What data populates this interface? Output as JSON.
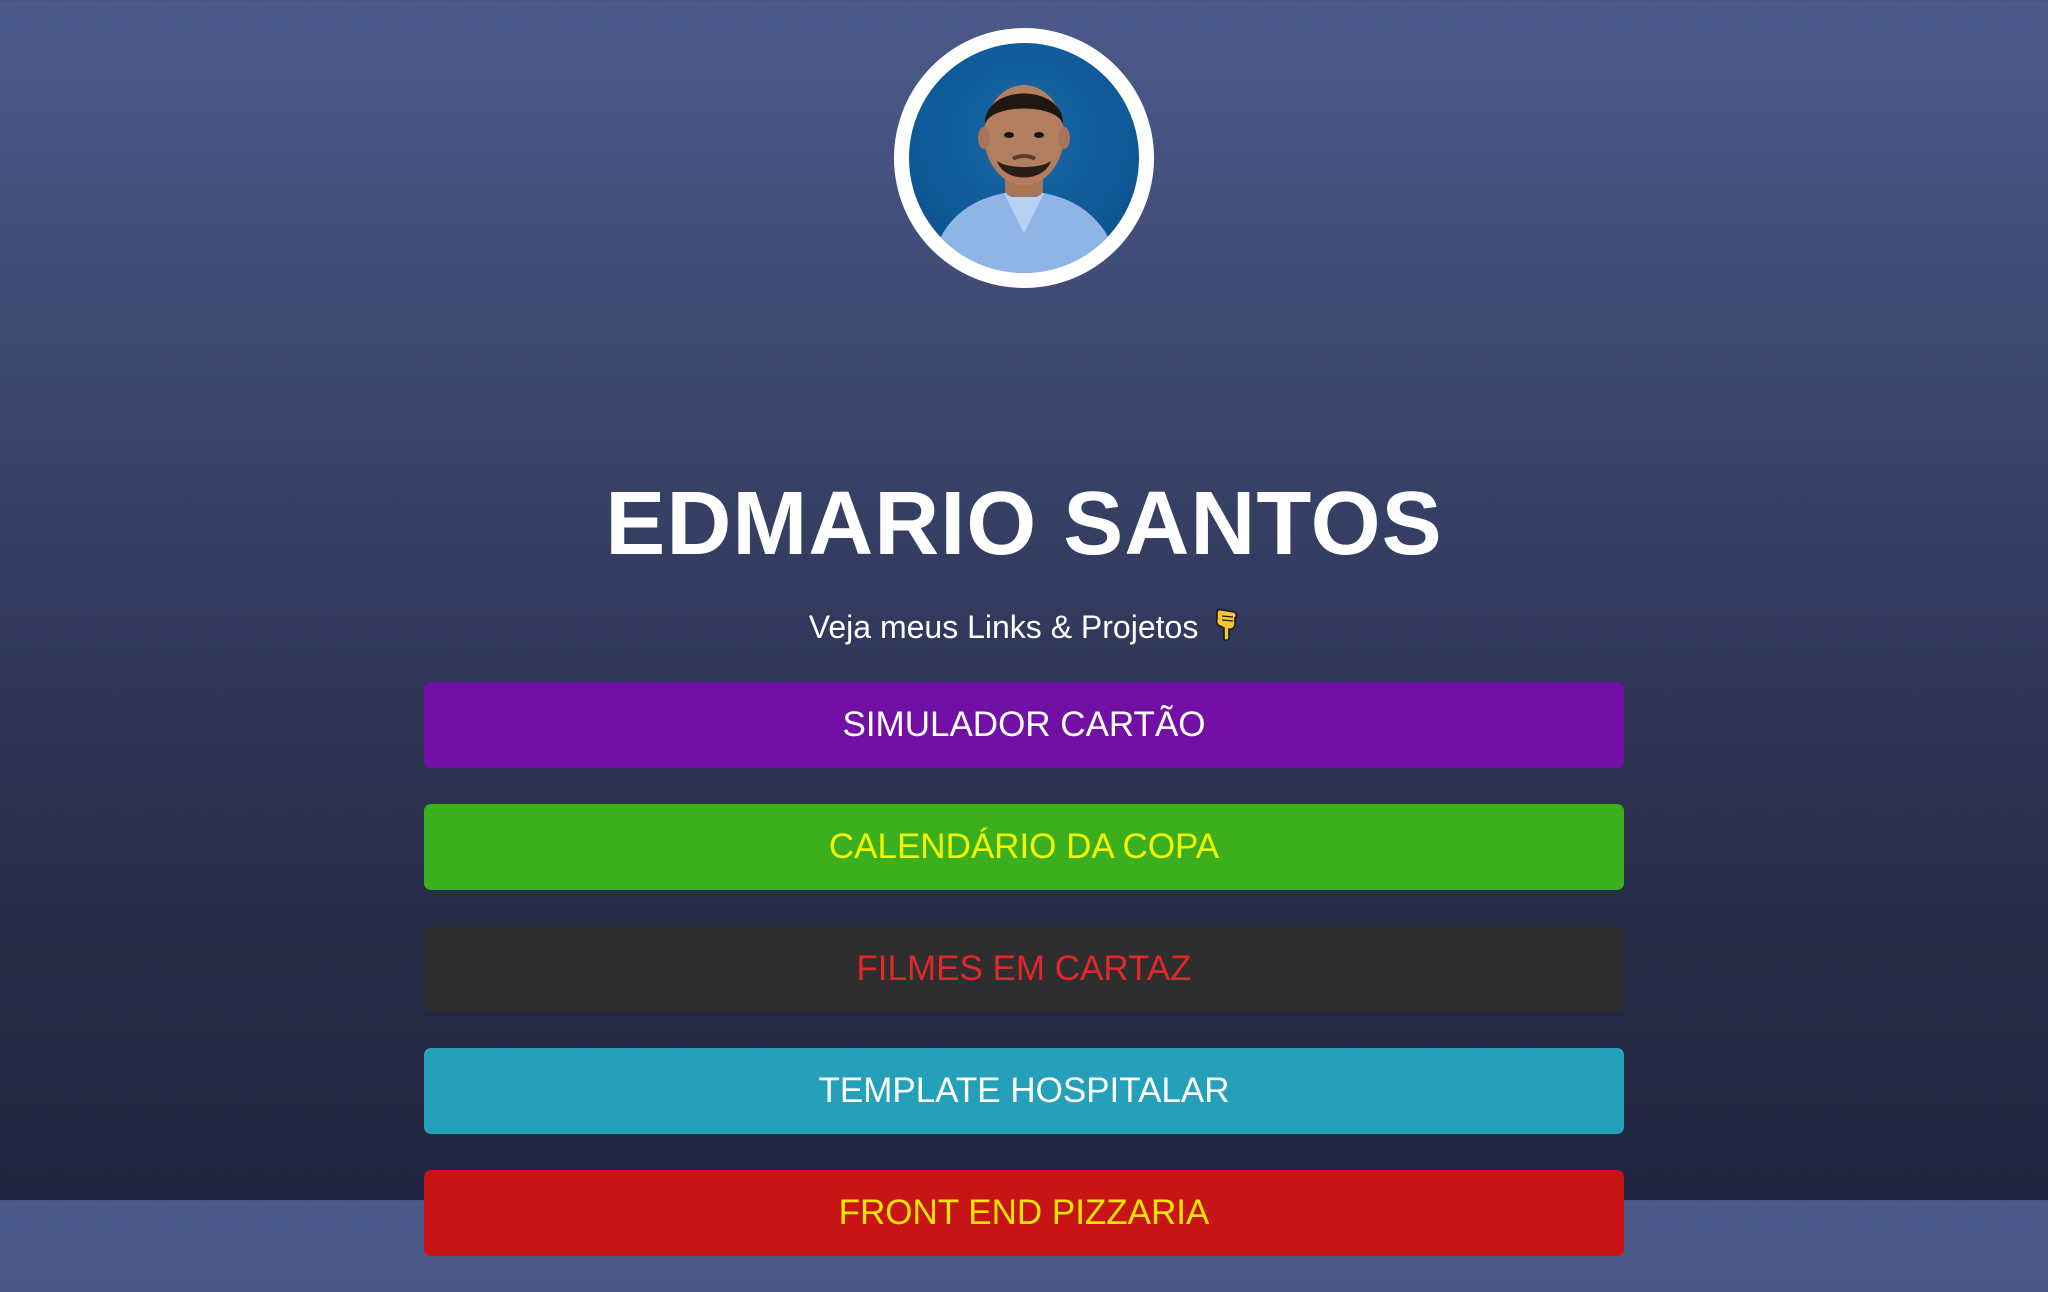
{
  "profile": {
    "name": "EDMARIO SANTOS",
    "subtitle": "Veja meus Links & Projetos",
    "subtitle_emoji": "pointing-down-hand-icon"
  },
  "links": [
    {
      "label": "SIMULADOR CARTÃO",
      "bg": "#7210a6",
      "color": "#ffffff"
    },
    {
      "label": "CALENDÁRIO DA COPA",
      "bg": "#3caf1e",
      "color": "#f5f500"
    },
    {
      "label": "FILMES EM CARTAZ",
      "bg": "#2d2e2d",
      "color": "#e0282a"
    },
    {
      "label": "TEMPLATE HOSPITALAR",
      "bg": "#24a0ba",
      "color": "#ffffff"
    },
    {
      "label": "FRONT END PIZZARIA",
      "bg": "#c81414",
      "color": "#f5e600"
    }
  ]
}
